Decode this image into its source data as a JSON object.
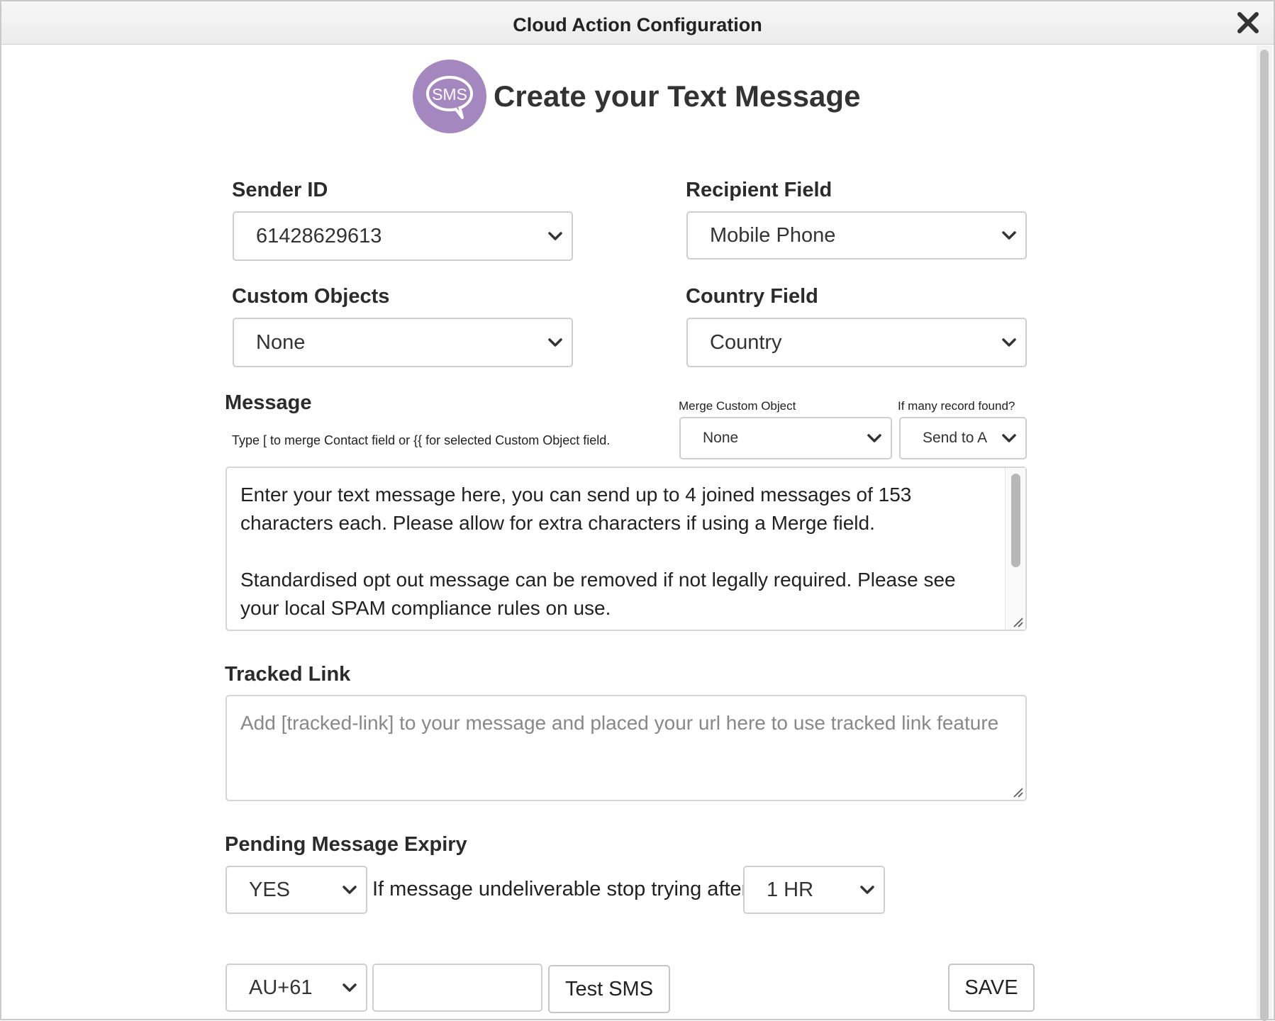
{
  "window": {
    "title": "Cloud Action Configuration"
  },
  "header": {
    "title": "Create your Text Message",
    "logo_text": "SMS"
  },
  "sender": {
    "label": "Sender ID",
    "value": "61428629613"
  },
  "recipient": {
    "label": "Recipient Field",
    "value": "Mobile Phone"
  },
  "custom_objects": {
    "label": "Custom Objects",
    "value": "None"
  },
  "country": {
    "label": "Country Field",
    "value": "Country"
  },
  "message": {
    "label": "Message",
    "hint": "Type [ to merge Contact field or {{ for selected Custom Object field.",
    "merge_label": "Merge Custom Object",
    "merge_value": "None",
    "many_label": "If many record found?",
    "many_value": "Send to A",
    "text": "Enter your text message here, you can send up to 4 joined messages of 153 characters each. Please allow for extra characters if using a Merge field.\n\nStandardised opt out message can be removed if not legally required. Please see your local SPAM compliance rules on use."
  },
  "tracked_link": {
    "label": "Tracked Link",
    "placeholder": "Add [tracked-link] to your message and placed your url here to use tracked link feature"
  },
  "expiry": {
    "label": "Pending Message Expiry",
    "enabled_value": "YES",
    "text": "If message undeliverable stop trying after",
    "duration_value": "1 HR"
  },
  "test": {
    "country_code": "AU+61",
    "phone_value": "",
    "button_label": "Test SMS"
  },
  "save": {
    "label": "SAVE"
  },
  "colors": {
    "logo_purple": "#a587c0",
    "text_dark": "#222222",
    "border": "#cfcfcf"
  }
}
